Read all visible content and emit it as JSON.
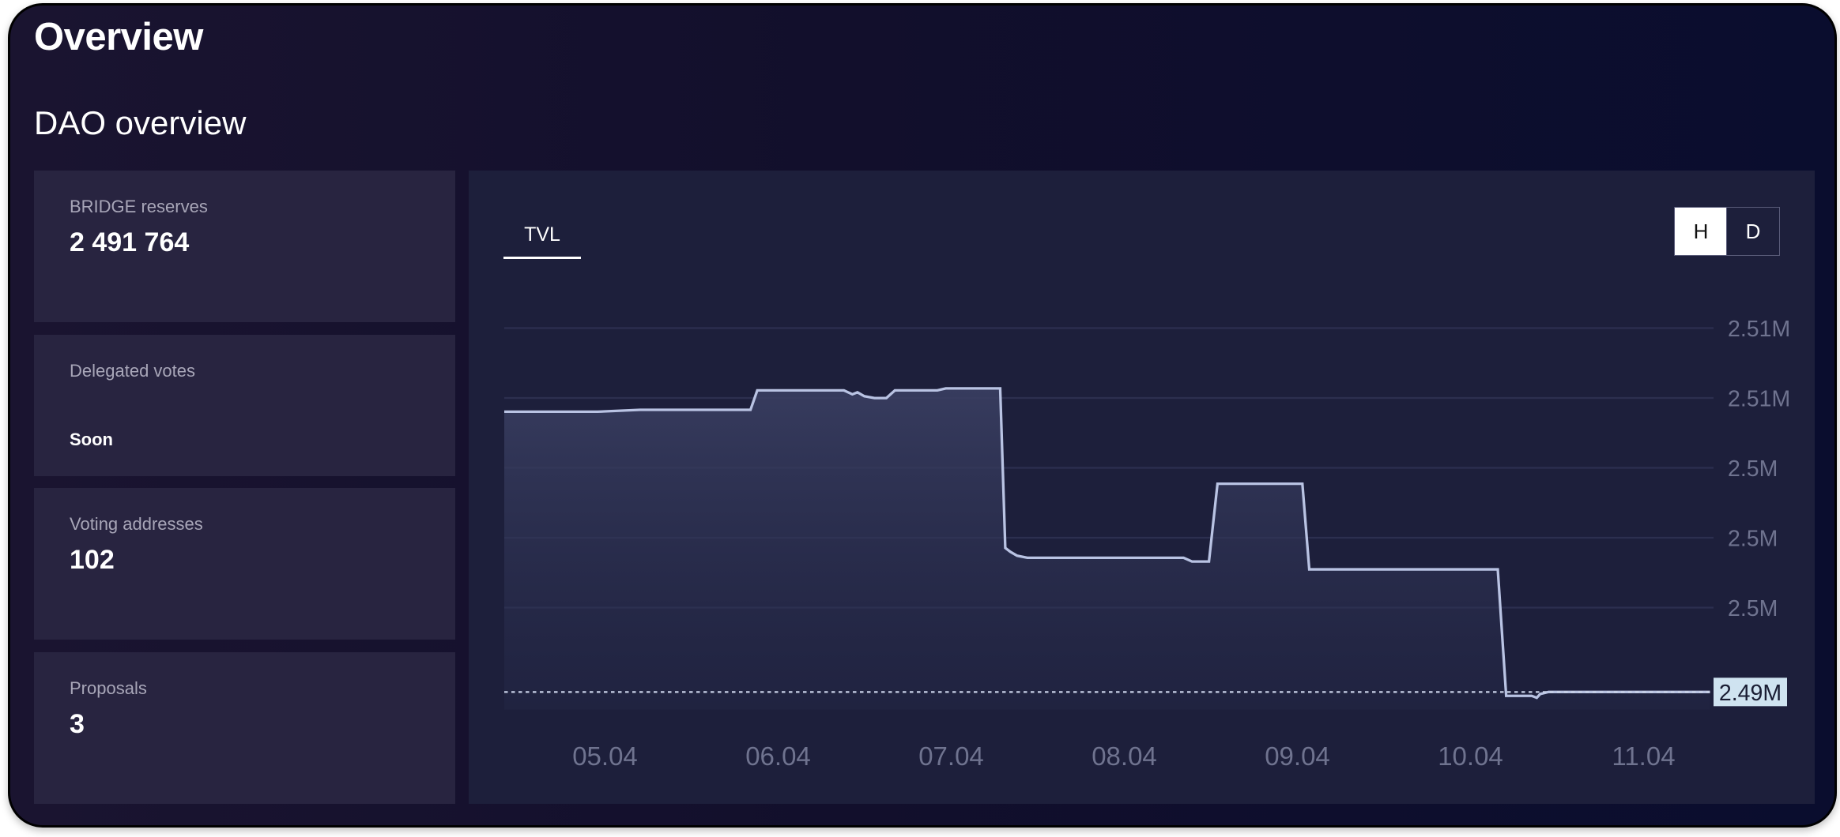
{
  "page": {
    "title": "Overview",
    "subtitle": "DAO overview"
  },
  "stats": [
    {
      "label": "BRIDGE reserves",
      "value": "2 491 764"
    },
    {
      "label": "Delegated votes",
      "value": "Soon"
    },
    {
      "label": "Voting addresses",
      "value": "102"
    },
    {
      "label": "Proposals",
      "value": "3"
    }
  ],
  "chart_panel": {
    "tab_label": "TVL",
    "toggle": {
      "h_label": "H",
      "d_label": "D",
      "active": "H"
    }
  },
  "colors": {
    "line": "#b9c3e3",
    "current_tag_bg": "#cfe3f0",
    "panel_bg": "#1d1f3b"
  },
  "chart_data": {
    "type": "area",
    "y_tick_labels": [
      "2.51M",
      "2.51M",
      "2.5M",
      "2.5M",
      "2.5M"
    ],
    "ylim": [
      2.4909,
      2.5105
    ],
    "x_tick_labels": [
      "05.04",
      "06.04",
      "07.04",
      "08.04",
      "09.04",
      "10.04",
      "11.04"
    ],
    "current_value_label": "2.49M",
    "current_value": 2.4918,
    "series": [
      {
        "x": [
          4.6,
          5.15,
          5.4,
          6.05,
          6.09,
          6.6,
          6.65,
          6.68,
          6.72,
          6.78,
          6.85,
          6.9,
          7.15,
          7.2,
          7.45,
          7.52,
          7.55,
          7.58,
          7.62,
          7.68,
          7.8,
          8.6,
          8.65,
          8.75,
          8.8,
          9.3,
          9.34,
          10.45,
          10.5,
          10.65,
          10.68,
          10.7,
          10.75,
          11.2,
          11.7
        ],
        "y": [
          2.5062,
          2.5062,
          2.5063,
          2.5063,
          2.5073,
          2.5073,
          2.5071,
          2.5072,
          2.507,
          2.5069,
          2.5069,
          2.5073,
          2.5073,
          2.5074,
          2.5074,
          2.5074,
          2.4992,
          2.499,
          2.4988,
          2.4987,
          2.4987,
          2.4987,
          2.4985,
          2.4985,
          2.5025,
          2.5025,
          2.4981,
          2.4981,
          2.4916,
          2.4916,
          2.4915,
          2.4917,
          2.4918,
          2.4918,
          2.4918
        ]
      }
    ]
  }
}
